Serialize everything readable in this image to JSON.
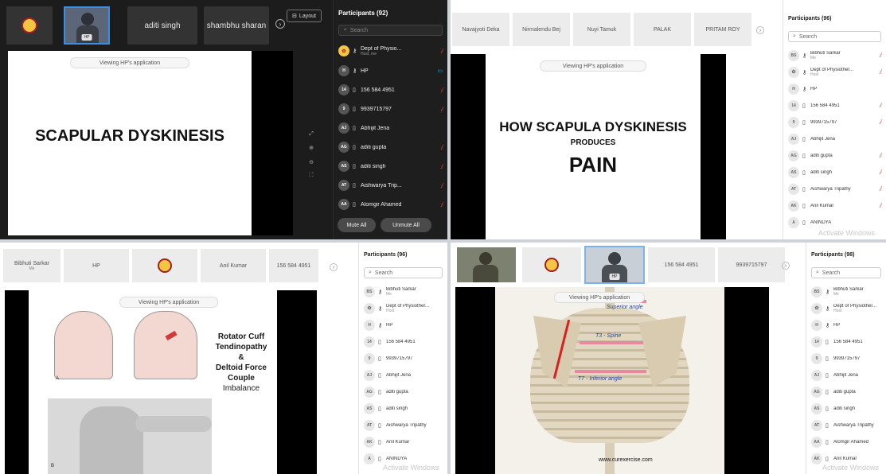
{
  "q1": {
    "tiles": [
      "aditi singh",
      "shambhu sharan"
    ],
    "video_tag": "HP",
    "layout_label": "Layout",
    "viewing_label": "Viewing HP's application",
    "slide_title": "SCAPULAR DYSKINESIS",
    "participants_title": "Participants (92)",
    "search_placeholder": "Search",
    "participants": [
      {
        "avatar": "",
        "name": "Dept of Physio...",
        "sub": "Host, me"
      },
      {
        "avatar": "H",
        "name": "HP",
        "sub": ""
      },
      {
        "avatar": "14",
        "name": "156 584 4951",
        "sub": ""
      },
      {
        "avatar": "9",
        "name": "9939715797",
        "sub": ""
      },
      {
        "avatar": "AJ",
        "name": "Abhijit Jena",
        "sub": ""
      },
      {
        "avatar": "AG",
        "name": "aditi gupta",
        "sub": ""
      },
      {
        "avatar": "AS",
        "name": "aditi singh",
        "sub": ""
      },
      {
        "avatar": "AT",
        "name": "Aishwarya Trip...",
        "sub": ""
      },
      {
        "avatar": "AA",
        "name": "Alomgir Ahamed",
        "sub": ""
      }
    ],
    "mute_all": "Mute All",
    "unmute_all": "Unmute All"
  },
  "q2": {
    "tiles": [
      "Navajyoti Deka",
      "Nirmalendu Bej",
      "Nuyi Tamuk",
      "PALAK",
      "PRITAM ROY"
    ],
    "viewing_label": "Viewing HP's application",
    "slide_line1": "HOW SCAPULA DYSKINESIS",
    "slide_line2": "PRODUCES",
    "slide_line3": "PAIN",
    "participants_title": "Participants (96)",
    "search_placeholder": "Search",
    "participants": [
      {
        "avatar": "BS",
        "name": "Bibhuti Sarkar",
        "sub": "Me"
      },
      {
        "avatar": "",
        "name": "Dept of Physiother...",
        "sub": "Host"
      },
      {
        "avatar": "H",
        "name": "HP",
        "sub": ""
      },
      {
        "avatar": "14",
        "name": "156 584 4951",
        "sub": ""
      },
      {
        "avatar": "9",
        "name": "9939715797",
        "sub": ""
      },
      {
        "avatar": "AJ",
        "name": "Abhijit Jena",
        "sub": ""
      },
      {
        "avatar": "AG",
        "name": "aditi gupta",
        "sub": ""
      },
      {
        "avatar": "AS",
        "name": "aditi singh",
        "sub": ""
      },
      {
        "avatar": "AT",
        "name": "Aishwarya Tripathy",
        "sub": ""
      },
      {
        "avatar": "AK",
        "name": "Anil Kumar",
        "sub": ""
      },
      {
        "avatar": "A",
        "name": "ANINDYA",
        "sub": ""
      }
    ],
    "watermark": "Activate Windows"
  },
  "q3": {
    "tiles": [
      {
        "name": "Bibhuti Sarkar",
        "sub": "Me"
      },
      {
        "name": "HP",
        "sub": ""
      },
      {
        "name": "",
        "sub": ""
      },
      {
        "name": "Anil Kumar",
        "sub": ""
      },
      {
        "name": "156 584 4951",
        "sub": ""
      }
    ],
    "viewing_label": "Viewing HP's application",
    "slide_lines": [
      "Rotator Cuff",
      "Tendinopathy",
      "&",
      "Deltoid Force",
      "Couple",
      "Imbalance"
    ],
    "label_a": "A",
    "label_b": "B",
    "participants_title": "Participants (96)",
    "search_placeholder": "Search",
    "participants": [
      {
        "avatar": "BS",
        "name": "Bibhuti Sarkar",
        "sub": "Me"
      },
      {
        "avatar": "",
        "name": "Dept of Physiother...",
        "sub": "Host"
      },
      {
        "avatar": "H",
        "name": "HP",
        "sub": ""
      },
      {
        "avatar": "14",
        "name": "156 584 4951",
        "sub": ""
      },
      {
        "avatar": "9",
        "name": "9939715797",
        "sub": ""
      },
      {
        "avatar": "AJ",
        "name": "Abhijit Jena",
        "sub": ""
      },
      {
        "avatar": "AG",
        "name": "aditi gupta",
        "sub": ""
      },
      {
        "avatar": "AS",
        "name": "aditi singh",
        "sub": ""
      },
      {
        "avatar": "AT",
        "name": "Aishwarya Tripathy",
        "sub": ""
      },
      {
        "avatar": "AK",
        "name": "Anil Kumar",
        "sub": ""
      },
      {
        "avatar": "A",
        "name": "ANINDYA",
        "sub": ""
      }
    ],
    "watermark": "Activate Windows"
  },
  "q4": {
    "tiles": [
      "156 584 4951",
      "9939715797"
    ],
    "video_tag": "HP",
    "viewing_label": "Viewing HP's application",
    "annotation_top": "Superior angle",
    "annotation_mid": "T3 - Spine",
    "annotation_bot": "T7 - Inferior angle",
    "caption": "www.curexercise.com",
    "participants_title": "Participants (98)",
    "search_placeholder": "Search",
    "participants": [
      {
        "avatar": "BS",
        "name": "Bibhuti Sarkar",
        "sub": "Me"
      },
      {
        "avatar": "",
        "name": "Dept of Physiother...",
        "sub": "Host"
      },
      {
        "avatar": "H",
        "name": "HP",
        "sub": ""
      },
      {
        "avatar": "14",
        "name": "156 584 4951",
        "sub": ""
      },
      {
        "avatar": "9",
        "name": "9939715797",
        "sub": ""
      },
      {
        "avatar": "AJ",
        "name": "Abhijit Jena",
        "sub": ""
      },
      {
        "avatar": "AG",
        "name": "aditi gupta",
        "sub": ""
      },
      {
        "avatar": "AS",
        "name": "aditi singh",
        "sub": ""
      },
      {
        "avatar": "AT",
        "name": "Aishwarya Tripathy",
        "sub": ""
      },
      {
        "avatar": "AA",
        "name": "Alomgir Ahamed",
        "sub": ""
      },
      {
        "avatar": "AK",
        "name": "Anil Kumar",
        "sub": ""
      }
    ],
    "watermark": "Activate Windows"
  },
  "colors": {
    "muted_mic": "#e14a3a",
    "camera": "#3aa2e1",
    "dark_bg": "#1c1c1c"
  }
}
